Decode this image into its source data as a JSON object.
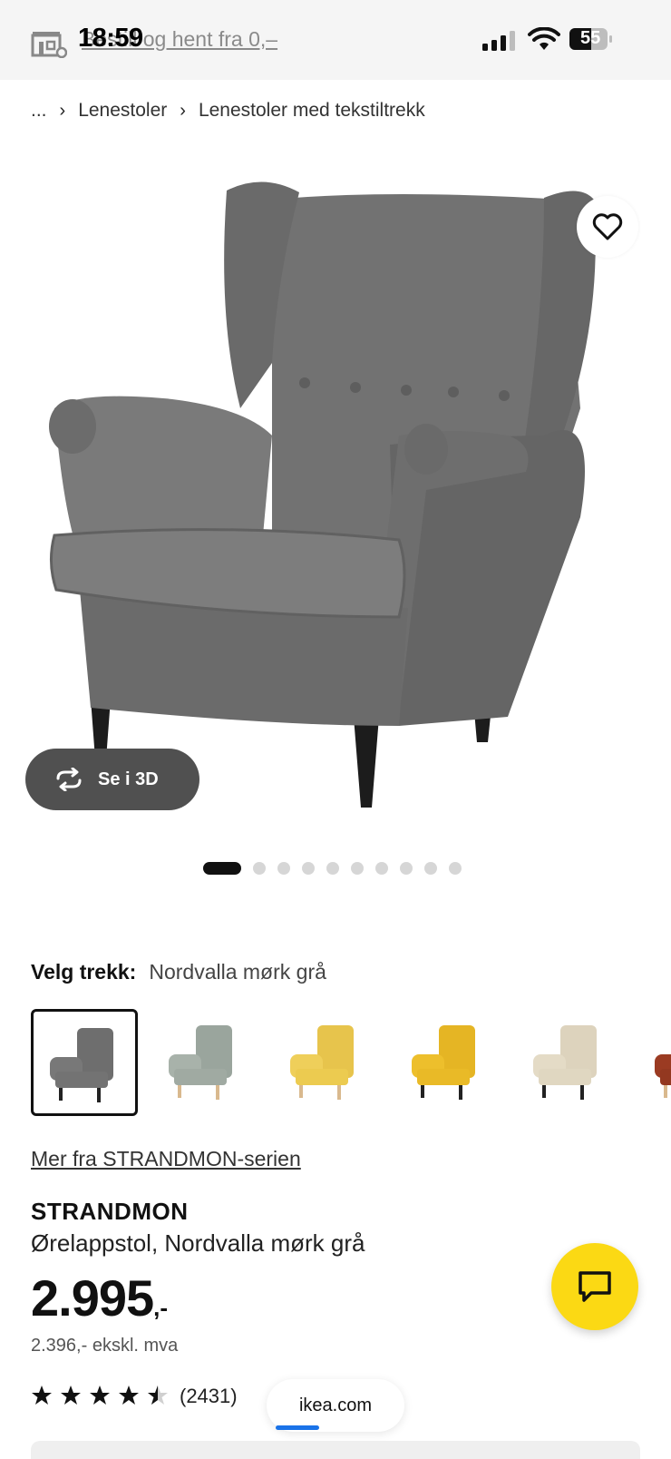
{
  "status_bar": {
    "time": "18:59",
    "ghost_link": "Bestill og hent fra 0,–",
    "battery": "55"
  },
  "breadcrumb": {
    "ellipsis": "...",
    "items": [
      "Lenestoler",
      "Lenestoler med tekstiltrekk"
    ]
  },
  "product_image": {
    "button_3d_label": "Se i 3D",
    "dots_count": 11,
    "active_dot": 0
  },
  "cover": {
    "label": "Velg trekk:",
    "value": "Nordvalla mørk grå",
    "swatches": [
      {
        "name": "Nordvalla mørk grå",
        "color": "#6e6e6e"
      },
      {
        "name": "rutet grønn/hvit",
        "color": "#9aa59d"
      },
      {
        "name": "gul",
        "color": "#e7c44c"
      },
      {
        "name": "gul/oker",
        "color": "#e5b524"
      },
      {
        "name": "beige",
        "color": "#ddd3bd"
      },
      {
        "name": "rød",
        "color": "#9b3b22"
      }
    ]
  },
  "series_link": "Mer fra STRANDMON-serien",
  "product": {
    "name": "STRANDMON",
    "description": "Ørelappstol, Nordvalla mørk grå",
    "price": "2.995",
    "price_suffix": ",-",
    "price_ex_vat": "2.396,- ekskl. mva",
    "rating": 4.5,
    "review_count": "(2431)"
  },
  "browser": {
    "url": "ikea.com"
  },
  "colors": {
    "chat_button": "#fbd914",
    "button_3d": "#505050",
    "chair_fabric": "#6f6f6f"
  }
}
